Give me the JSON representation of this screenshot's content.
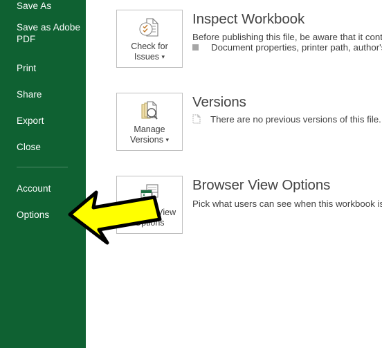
{
  "app": {
    "accent_green": "#0f6132",
    "panel_background": "#ffffff",
    "annotation_color": "#ffff00",
    "annotation_outline": "#000000"
  },
  "sidebar": {
    "items": [
      {
        "label": "Save As",
        "name": "save-as"
      },
      {
        "label": "Save as Adobe\nPDF",
        "name": "save-as-adobe-pdf"
      },
      {
        "label": "Print",
        "name": "print"
      },
      {
        "label": "Share",
        "name": "share"
      },
      {
        "label": "Export",
        "name": "export"
      },
      {
        "label": "Close",
        "name": "close"
      },
      {
        "label": "Account",
        "name": "account"
      },
      {
        "label": "Options",
        "name": "options"
      }
    ]
  },
  "main": {
    "sections": [
      {
        "title": "Inspect Workbook",
        "description": "Before publishing this file, be aware that it contains:",
        "bullet": "Document properties, printer path, author's na",
        "bullet_icon": "square-bullet-icon",
        "button": {
          "label_line1": "Check for",
          "label_line2": "Issues",
          "caret": "▾",
          "icon": "document-checklist-icon"
        }
      },
      {
        "title": "Versions",
        "description": "",
        "bullet": "There are no previous versions of this file.",
        "bullet_icon": "document-outline-icon",
        "button": {
          "label_line1": "Manage",
          "label_line2": "Versions",
          "caret": "▾",
          "icon": "document-stack-search-icon"
        }
      },
      {
        "title": "Browser View Options",
        "description": "Pick what users can see when this workbook is view",
        "bullet": "",
        "bullet_icon": "",
        "button": {
          "label_line1": "Browser View",
          "label_line2": "Options",
          "caret": "",
          "icon": "browser-window-icon"
        }
      }
    ]
  },
  "annotation": {
    "type": "left-pointing-arrow",
    "points_to": "Options"
  }
}
